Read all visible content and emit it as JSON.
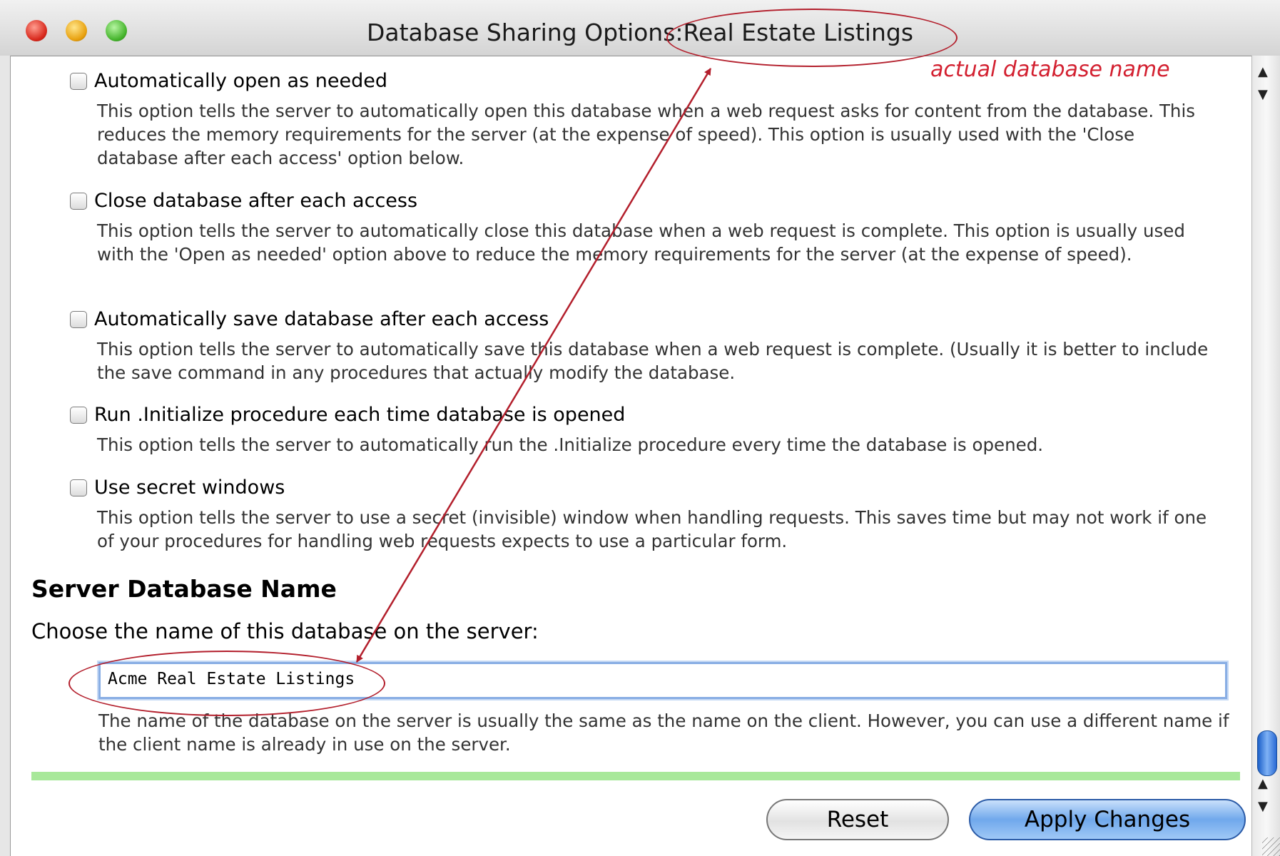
{
  "window": {
    "title": "Database Sharing Options:Real Estate Listings"
  },
  "options": [
    {
      "label": "Automatically open as needed",
      "description": "This option tells the server to automatically open this database when a web request asks for content from the database. This reduces the memory requirements for the server (at the expense of speed). This option is usually used with the 'Close database after each access' option below.",
      "checked": false
    },
    {
      "label": "Close database after each access",
      "description": "This option tells the server to automatically close this database when a web request is complete. This option is usually used with the 'Open as needed' option above to reduce the memory requirements for the server (at the expense of speed).",
      "checked": false
    },
    {
      "label": "Automatically save database after each access",
      "description": "This option tells the server to automatically save this database when a web request is complete. (Usually it is better to include the save command in any procedures that actually modify the database.",
      "checked": false
    },
    {
      "label": "Run .Initialize procedure each time database is opened",
      "description": "This option tells the server to automatically run the .Initialize procedure every time the database is opened.",
      "checked": false
    },
    {
      "label": "Use secret windows",
      "description": "This option tells the server to use a secret (invisible) window when handling requests. This saves time but may not work if one of your procedures for handling web requests expects to use a particular form.",
      "checked": false
    }
  ],
  "server_name": {
    "heading": "Server Database Name",
    "prompt": "Choose the name of this database on the server:",
    "value": "Acme Real Estate Listings",
    "description": "The name of the database on the server is usually the same as the name on the client. However, you can use a different name if the client name is already in use on the server."
  },
  "buttons": {
    "reset": "Reset",
    "apply": "Apply Changes"
  },
  "annotation": {
    "label": "actual database name",
    "color": "#d32030"
  },
  "scrollbar": {
    "up_arrow": "▲",
    "down_arrow": "▼"
  }
}
